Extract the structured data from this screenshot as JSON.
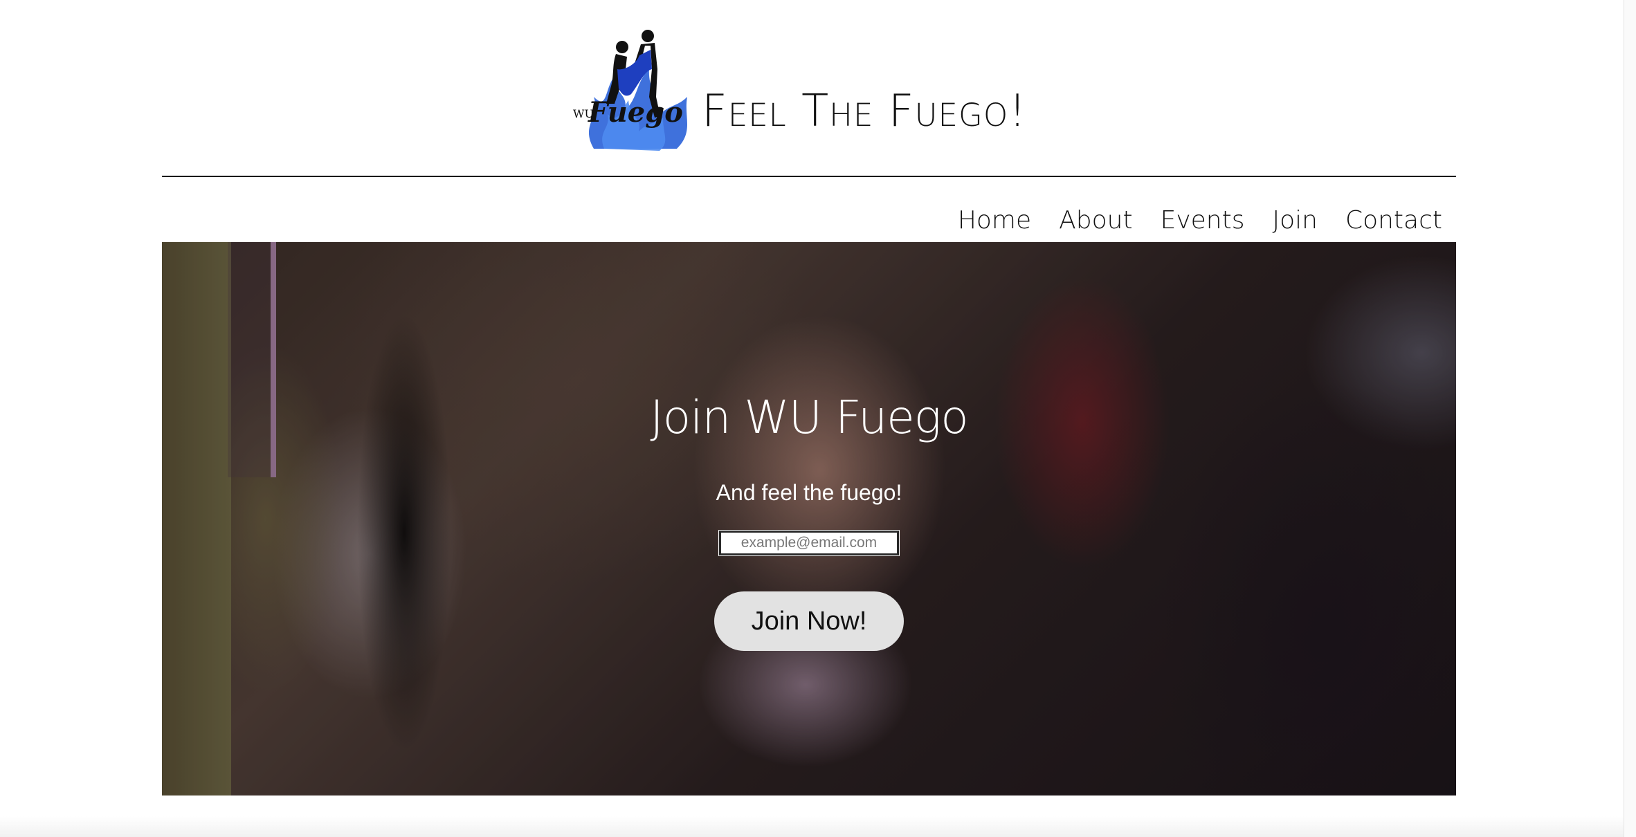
{
  "header": {
    "logo_name": "wu-fuego-dancers-logo",
    "logo_text_small": "WU",
    "logo_text_script": "Fuego",
    "site_title": "Feel The Fuego!"
  },
  "nav": {
    "items": [
      {
        "label": "Home"
      },
      {
        "label": "About"
      },
      {
        "label": "Events"
      },
      {
        "label": "Join"
      },
      {
        "label": "Contact"
      }
    ]
  },
  "hero": {
    "title": "Join WU Fuego",
    "subtitle": "And feel the fuego!",
    "email_placeholder": "example@email.com",
    "email_value": "",
    "button_label": "Join Now!"
  },
  "colors": {
    "text": "#111111",
    "hero_text": "#ffffff",
    "button_bg": "#e2e2e2",
    "logo_blue": "#1e3fbf"
  }
}
